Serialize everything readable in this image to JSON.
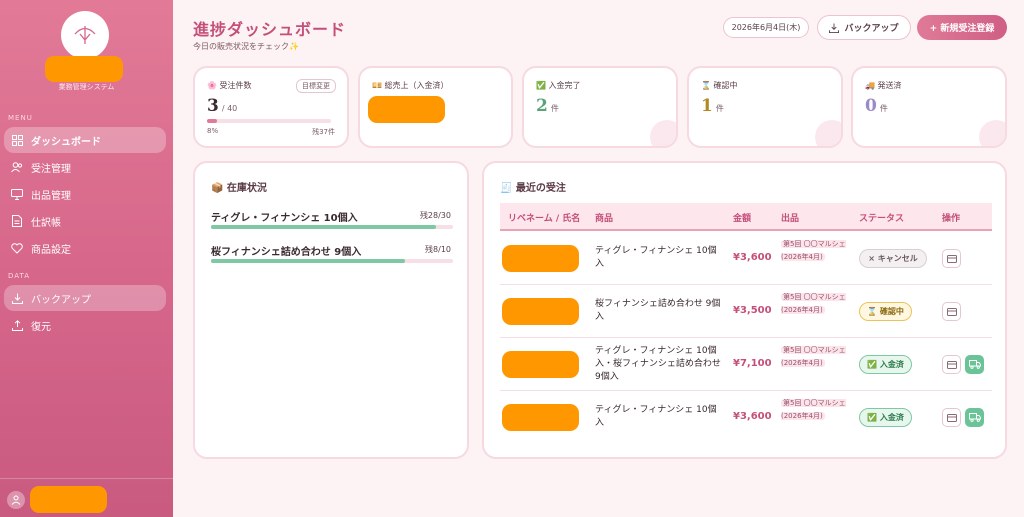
{
  "sidebar": {
    "logo_icon": "umbrella-icon",
    "subtitle": "業務管理システム",
    "menu_label": "MENU",
    "data_label": "DATA",
    "items": [
      {
        "label": "ダッシュボード",
        "icon": "grid-icon",
        "active": true
      },
      {
        "label": "受注管理",
        "icon": "users-icon"
      },
      {
        "label": "出品管理",
        "icon": "monitor-icon"
      },
      {
        "label": "仕訳帳",
        "icon": "document-icon"
      },
      {
        "label": "商品設定",
        "icon": "heart-icon"
      }
    ],
    "data_items": [
      {
        "label": "バックアップ",
        "icon": "download-icon"
      },
      {
        "label": "復元",
        "icon": "upload-icon"
      }
    ]
  },
  "header": {
    "title": "進捗ダッシュボード",
    "subtitle": "今日の販売状況をチェック✨",
    "date": "2026年6月4日(木)",
    "backup_label": "バックアップ",
    "new_order_label": "+ 新規受注登録"
  },
  "stats": {
    "orders": {
      "label": "🌸 受注件数",
      "value": "3",
      "target": "/ 40",
      "edit_label": "目標変更",
      "percent": "8%",
      "progress": 0.08,
      "remaining": "残37件"
    },
    "sales": {
      "label": "💴 総売上（入金済）"
    },
    "paid": {
      "label": "✅ 入金完了",
      "value": "2",
      "unit": "件",
      "color": "#5aa37a"
    },
    "confirming": {
      "label": "⌛ 確認中",
      "value": "1",
      "unit": "件",
      "color": "#b08a20"
    },
    "shipped": {
      "label": "🚚 発送済",
      "value": "0",
      "unit": "件",
      "color": "#9a8ac8"
    }
  },
  "inventory": {
    "title": "📦 在庫状況",
    "items": [
      {
        "name": "ティグレ・フィナンシェ 10個入",
        "stock": "残28/30",
        "fill": 0.93
      },
      {
        "name": "桜フィナンシェ詰め合わせ 9個入",
        "stock": "残8/10",
        "fill": 0.8
      }
    ]
  },
  "orders": {
    "title": "🧾 最近の受注",
    "headers": [
      "リベネーム / 氏名",
      "商品",
      "金額",
      "出品",
      "ステータス",
      "操作"
    ],
    "rows": [
      {
        "product": "ティグレ・フィナンシェ 10個入",
        "amount": "¥3,600",
        "listing": "第5回 〇〇マルシェ (2026年4月)",
        "status": "× キャンセル",
        "status_type": "cancel"
      },
      {
        "product": "桜フィナンシェ詰め合わせ 9個入",
        "amount": "¥3,500",
        "listing": "第5回 〇〇マルシェ (2026年4月)",
        "status": "⌛ 確認中",
        "status_type": "confirm"
      },
      {
        "product": "ティグレ・フィナンシェ 10個入・桜フィナンシェ詰め合わせ 9個入",
        "amount": "¥7,100",
        "listing": "第5回 〇〇マルシェ (2026年4月)",
        "status": "✅ 入金済",
        "status_type": "paid"
      },
      {
        "product": "ティグレ・フィナンシェ 10個入",
        "amount": "¥3,600",
        "listing": "第5回 〇〇マルシェ (2026年4月)",
        "status": "✅ 入金済",
        "status_type": "paid"
      }
    ]
  }
}
